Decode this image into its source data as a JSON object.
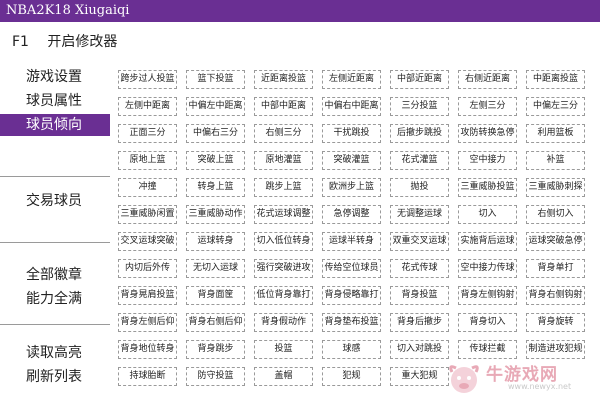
{
  "window": {
    "title": "NBA2K18 Xiugaiqi"
  },
  "menubar": {
    "key": "F1",
    "label": "开启修改器"
  },
  "sidebar": {
    "items": [
      {
        "label": "游戏设置"
      },
      {
        "label": "球员属性"
      },
      {
        "label": "球员倾向"
      },
      {
        "label": "交易球员"
      },
      {
        "label": "全部徽章"
      },
      {
        "label": "能力全满"
      },
      {
        "label": "读取高亮"
      },
      {
        "label": "刷新列表"
      }
    ],
    "active_index": 2
  },
  "grid": {
    "rows": [
      [
        "跨步过人投篮",
        "篮下投篮",
        "近距离投篮",
        "左侧近距离",
        "中部近距离",
        "右侧近距离",
        "中距离投篮"
      ],
      [
        "左侧中距离",
        "中偏左中距离",
        "中部中距离",
        "中偏右中距离",
        "三分投篮",
        "左侧三分",
        "中偏左三分"
      ],
      [
        "正面三分",
        "中偏右三分",
        "右侧三分",
        "干扰跳投",
        "后撤步跳投",
        "攻防转换急停",
        "利用篮板"
      ],
      [
        "原地上篮",
        "突破上篮",
        "原地灌篮",
        "突破灌篮",
        "花式灌篮",
        "空中接力",
        "补篮"
      ],
      [
        "冲撞",
        "转身上篮",
        "跳步上篮",
        "欧洲步上篮",
        "抛投",
        "三重威胁投篮",
        "三重威胁刺探"
      ],
      [
        "三重威胁闲置",
        "三重威胁动作",
        "花式运球调整",
        "急停调整",
        "无调整运球",
        "切入",
        "右侧切入"
      ],
      [
        "交叉运球突破",
        "运球转身",
        "切入低位转身",
        "运球半转身",
        "双重交叉运球",
        "实施背后运球",
        "运球突破急停"
      ],
      [
        "内切后外传",
        "无切入运球",
        "强行突破进攻",
        "传给空位球员",
        "花式传球",
        "空中接力传球",
        "背身单打"
      ],
      [
        "背身晃肩投篮",
        "背身面筐",
        "低位背身靠打",
        "背身侵略靠打",
        "背身投篮",
        "背身左侧钩射",
        "背身右侧钩射"
      ],
      [
        "背身左侧后仰",
        "背身右侧后仰",
        "背身假动作",
        "背身垫布投篮",
        "背身后撤步",
        "背身切入",
        "背身旋转"
      ],
      [
        "背身地位转身",
        "背身跳步",
        "投篮",
        "球感",
        "切入对跳投",
        "传球拦截",
        "制造进攻犯规"
      ],
      [
        "持球胎断",
        "防守投篮",
        "盖帽",
        "犯规",
        "重大犯规"
      ]
    ]
  },
  "watermark": {
    "text": "牛游戏网",
    "url": "www.newyx.net"
  },
  "colors": {
    "accent": "#6a2f93",
    "cell_border": "#9a9a9a",
    "watermark": "#e8a9b6"
  }
}
